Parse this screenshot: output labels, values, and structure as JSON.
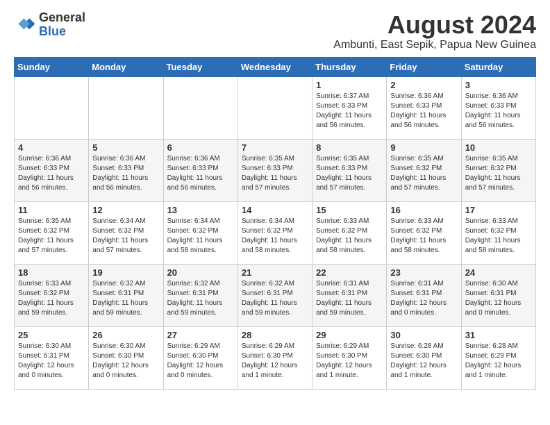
{
  "header": {
    "logo_general": "General",
    "logo_blue": "Blue",
    "title": "August 2024",
    "subtitle": "Ambunti, East Sepik, Papua New Guinea"
  },
  "days_of_week": [
    "Sunday",
    "Monday",
    "Tuesday",
    "Wednesday",
    "Thursday",
    "Friday",
    "Saturday"
  ],
  "weeks": [
    [
      {
        "day": "",
        "info": ""
      },
      {
        "day": "",
        "info": ""
      },
      {
        "day": "",
        "info": ""
      },
      {
        "day": "",
        "info": ""
      },
      {
        "day": "1",
        "info": "Sunrise: 6:37 AM\nSunset: 6:33 PM\nDaylight: 11 hours\nand 56 minutes."
      },
      {
        "day": "2",
        "info": "Sunrise: 6:36 AM\nSunset: 6:33 PM\nDaylight: 11 hours\nand 56 minutes."
      },
      {
        "day": "3",
        "info": "Sunrise: 6:36 AM\nSunset: 6:33 PM\nDaylight: 11 hours\nand 56 minutes."
      }
    ],
    [
      {
        "day": "4",
        "info": "Sunrise: 6:36 AM\nSunset: 6:33 PM\nDaylight: 11 hours\nand 56 minutes."
      },
      {
        "day": "5",
        "info": "Sunrise: 6:36 AM\nSunset: 6:33 PM\nDaylight: 11 hours\nand 56 minutes."
      },
      {
        "day": "6",
        "info": "Sunrise: 6:36 AM\nSunset: 6:33 PM\nDaylight: 11 hours\nand 56 minutes."
      },
      {
        "day": "7",
        "info": "Sunrise: 6:35 AM\nSunset: 6:33 PM\nDaylight: 11 hours\nand 57 minutes."
      },
      {
        "day": "8",
        "info": "Sunrise: 6:35 AM\nSunset: 6:33 PM\nDaylight: 11 hours\nand 57 minutes."
      },
      {
        "day": "9",
        "info": "Sunrise: 6:35 AM\nSunset: 6:32 PM\nDaylight: 11 hours\nand 57 minutes."
      },
      {
        "day": "10",
        "info": "Sunrise: 6:35 AM\nSunset: 6:32 PM\nDaylight: 11 hours\nand 57 minutes."
      }
    ],
    [
      {
        "day": "11",
        "info": "Sunrise: 6:35 AM\nSunset: 6:32 PM\nDaylight: 11 hours\nand 57 minutes."
      },
      {
        "day": "12",
        "info": "Sunrise: 6:34 AM\nSunset: 6:32 PM\nDaylight: 11 hours\nand 57 minutes."
      },
      {
        "day": "13",
        "info": "Sunrise: 6:34 AM\nSunset: 6:32 PM\nDaylight: 11 hours\nand 58 minutes."
      },
      {
        "day": "14",
        "info": "Sunrise: 6:34 AM\nSunset: 6:32 PM\nDaylight: 11 hours\nand 58 minutes."
      },
      {
        "day": "15",
        "info": "Sunrise: 6:33 AM\nSunset: 6:32 PM\nDaylight: 11 hours\nand 58 minutes."
      },
      {
        "day": "16",
        "info": "Sunrise: 6:33 AM\nSunset: 6:32 PM\nDaylight: 11 hours\nand 58 minutes."
      },
      {
        "day": "17",
        "info": "Sunrise: 6:33 AM\nSunset: 6:32 PM\nDaylight: 11 hours\nand 58 minutes."
      }
    ],
    [
      {
        "day": "18",
        "info": "Sunrise: 6:33 AM\nSunset: 6:32 PM\nDaylight: 11 hours\nand 59 minutes."
      },
      {
        "day": "19",
        "info": "Sunrise: 6:32 AM\nSunset: 6:31 PM\nDaylight: 11 hours\nand 59 minutes."
      },
      {
        "day": "20",
        "info": "Sunrise: 6:32 AM\nSunset: 6:31 PM\nDaylight: 11 hours\nand 59 minutes."
      },
      {
        "day": "21",
        "info": "Sunrise: 6:32 AM\nSunset: 6:31 PM\nDaylight: 11 hours\nand 59 minutes."
      },
      {
        "day": "22",
        "info": "Sunrise: 6:31 AM\nSunset: 6:31 PM\nDaylight: 11 hours\nand 59 minutes."
      },
      {
        "day": "23",
        "info": "Sunrise: 6:31 AM\nSunset: 6:31 PM\nDaylight: 12 hours\nand 0 minutes."
      },
      {
        "day": "24",
        "info": "Sunrise: 6:30 AM\nSunset: 6:31 PM\nDaylight: 12 hours\nand 0 minutes."
      }
    ],
    [
      {
        "day": "25",
        "info": "Sunrise: 6:30 AM\nSunset: 6:31 PM\nDaylight: 12 hours\nand 0 minutes."
      },
      {
        "day": "26",
        "info": "Sunrise: 6:30 AM\nSunset: 6:30 PM\nDaylight: 12 hours\nand 0 minutes."
      },
      {
        "day": "27",
        "info": "Sunrise: 6:29 AM\nSunset: 6:30 PM\nDaylight: 12 hours\nand 0 minutes."
      },
      {
        "day": "28",
        "info": "Sunrise: 6:29 AM\nSunset: 6:30 PM\nDaylight: 12 hours\nand 1 minute."
      },
      {
        "day": "29",
        "info": "Sunrise: 6:29 AM\nSunset: 6:30 PM\nDaylight: 12 hours\nand 1 minute."
      },
      {
        "day": "30",
        "info": "Sunrise: 6:28 AM\nSunset: 6:30 PM\nDaylight: 12 hours\nand 1 minute."
      },
      {
        "day": "31",
        "info": "Sunrise: 6:28 AM\nSunset: 6:29 PM\nDaylight: 12 hours\nand 1 minute."
      }
    ]
  ]
}
